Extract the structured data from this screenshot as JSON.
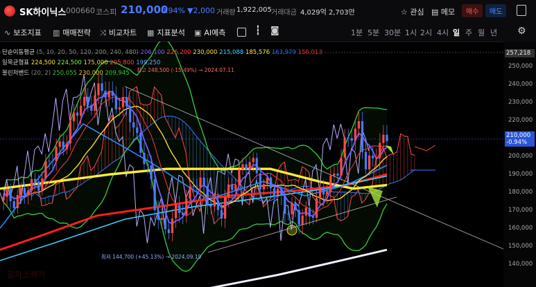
{
  "header": {
    "stock_name": "SK하이닉스",
    "code": "000660",
    "market": "코스피",
    "price": "210,000",
    "change_pct": "-0.94%",
    "change": "▼2,000",
    "volume_label": "거래량",
    "volume": "1,922,005",
    "amount_label": "거래대금",
    "amount": "4,029억 2,703만",
    "favorite_label": "관심",
    "memo_label": "메모",
    "buy_label": "매수",
    "sell_label": "매도",
    "colors": {
      "down": "#4b7bff",
      "up": "#ff4a4a"
    }
  },
  "toolbar": {
    "tools": [
      {
        "label": "보조지표",
        "icon": "indicator-icon"
      },
      {
        "label": "매매전략",
        "icon": "strategy-icon"
      },
      {
        "label": "비교차트",
        "icon": "compare-icon"
      },
      {
        "label": "지표분석",
        "icon": "analysis-icon"
      },
      {
        "label": "AI예측",
        "icon": "ai-icon"
      }
    ],
    "periods": [
      "1분",
      "5분",
      "30분",
      "1시",
      "2시",
      "4시",
      "일",
      "주",
      "월",
      "년"
    ],
    "active_period": "일"
  },
  "legend": {
    "ma": {
      "label": "단순이동평균",
      "params": "(5, 10, 20, 50, 120, 200, 240, 480)",
      "values": [
        "206,100",
        "226,200",
        "230,000",
        "215,088",
        "185,576",
        "163,979",
        "156,013"
      ],
      "colors": [
        "#7b5cff",
        "#ff3a3a",
        "#ffd83a",
        "#3ad0ff",
        "#ffe23a",
        "#2a6bff",
        "#ff2a2a"
      ]
    },
    "ichimoku": {
      "label": "일목균형표",
      "values": [
        "224,500",
        "224,500",
        "175,000",
        "205,800",
        "199,250"
      ],
      "colors": [
        "#ffe23a",
        "#7cff3a",
        "#ffd83a",
        "#ff4a4a",
        "#6fa8ff"
      ]
    },
    "bollinger": {
      "label": "볼린저밴드",
      "params": "(20, 2)",
      "values": [
        "250,055",
        "230,000",
        "209,945"
      ],
      "colors": [
        "#36c23a",
        "#e0c830",
        "#36c23a"
      ]
    }
  },
  "annotations": {
    "high": "최고 248,500 (-15.49%) → 2024.07.11",
    "low": "최저 144,700 (+45.13%) → 2024.09.19"
  },
  "y_axis": {
    "ticks": [
      "250,000",
      "240,000",
      "230,000",
      "220,000",
      "210,000",
      "200,000",
      "190,000",
      "180,000",
      "170,000",
      "160,000",
      "150,000",
      "140,000"
    ],
    "top_tag": "257,218",
    "price_tag": "210,000",
    "price_tag_pct": "-0.94%"
  },
  "watermark": "알파스퀘어"
}
